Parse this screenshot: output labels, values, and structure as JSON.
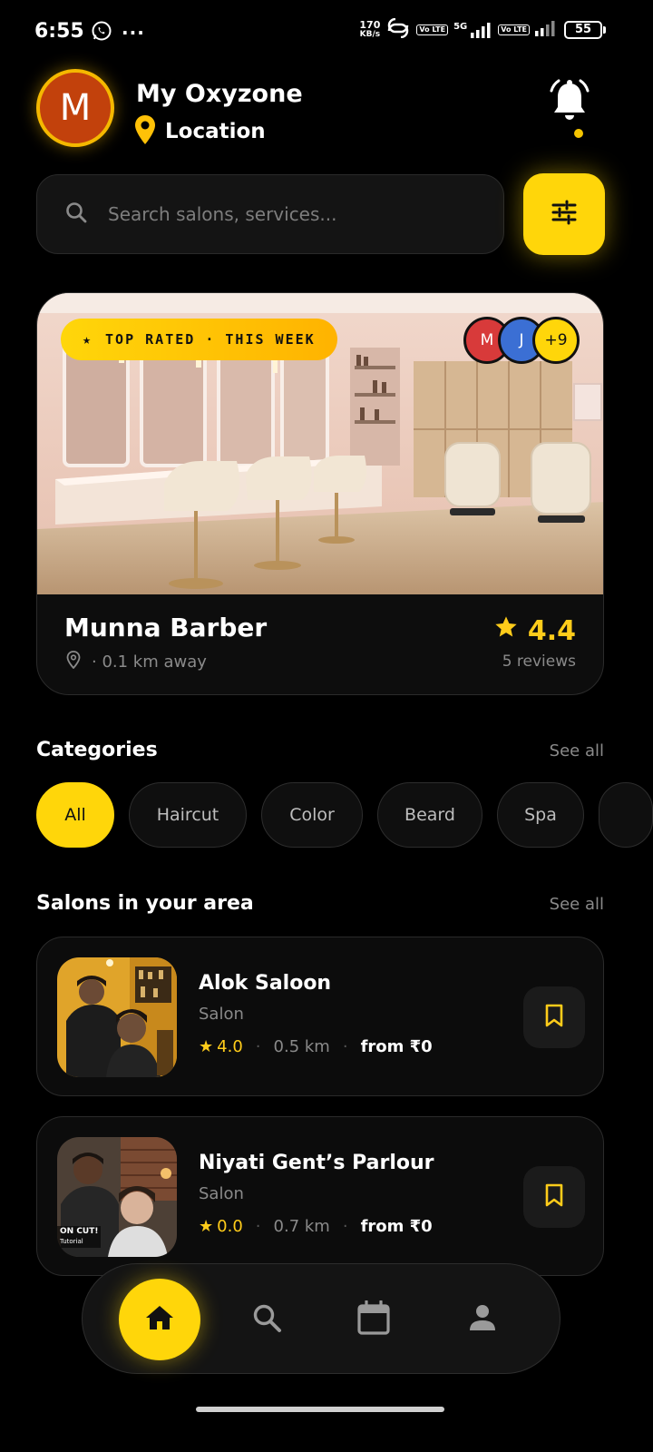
{
  "status_bar": {
    "time": "6:55",
    "net_speed_value": "170",
    "net_speed_unit": "KB/s",
    "network_5g": "5G",
    "volte_label": "Vo LTE",
    "battery": "55"
  },
  "header": {
    "avatar_initial": "M",
    "app_title": "My Oxyzone",
    "location_label": "Location"
  },
  "search": {
    "placeholder": "Search salons, services..."
  },
  "featured": {
    "badge": "TOP RATED · THIS WEEK",
    "badge_star": "★",
    "faces": [
      {
        "initial": "M",
        "color": "#d83a3a"
      },
      {
        "initial": "J",
        "color": "#3b6fd4"
      },
      {
        "initial": "+9",
        "color": "#ffd60a"
      }
    ],
    "name": "Munna Barber",
    "distance": "· 0.1 km away",
    "rating": "4.4",
    "reviews": "5 reviews"
  },
  "categories": {
    "title": "Categories",
    "see_all": "See all",
    "items": [
      {
        "label": "All",
        "active": true
      },
      {
        "label": "Haircut",
        "active": false
      },
      {
        "label": "Color",
        "active": false
      },
      {
        "label": "Beard",
        "active": false
      },
      {
        "label": "Spa",
        "active": false
      }
    ]
  },
  "salons": {
    "title": "Salons in your area",
    "see_all": "See all",
    "items": [
      {
        "name": "Alok Saloon",
        "type": "Salon",
        "rating": "4.0",
        "distance": "0.5 km",
        "price": "from ₹0"
      },
      {
        "name": "Niyati Gent’s Parlour",
        "type": "Salon",
        "rating": "0.0",
        "distance": "0.7 km",
        "price": "from ₹0"
      }
    ]
  },
  "thumb_caption": {
    "line1": "ON CUT!",
    "line2": "Tutorial"
  },
  "colors": {
    "accent": "#ffd60a",
    "background": "#000000",
    "card": "#0d0d0d",
    "rating": "#ffcc1a"
  }
}
